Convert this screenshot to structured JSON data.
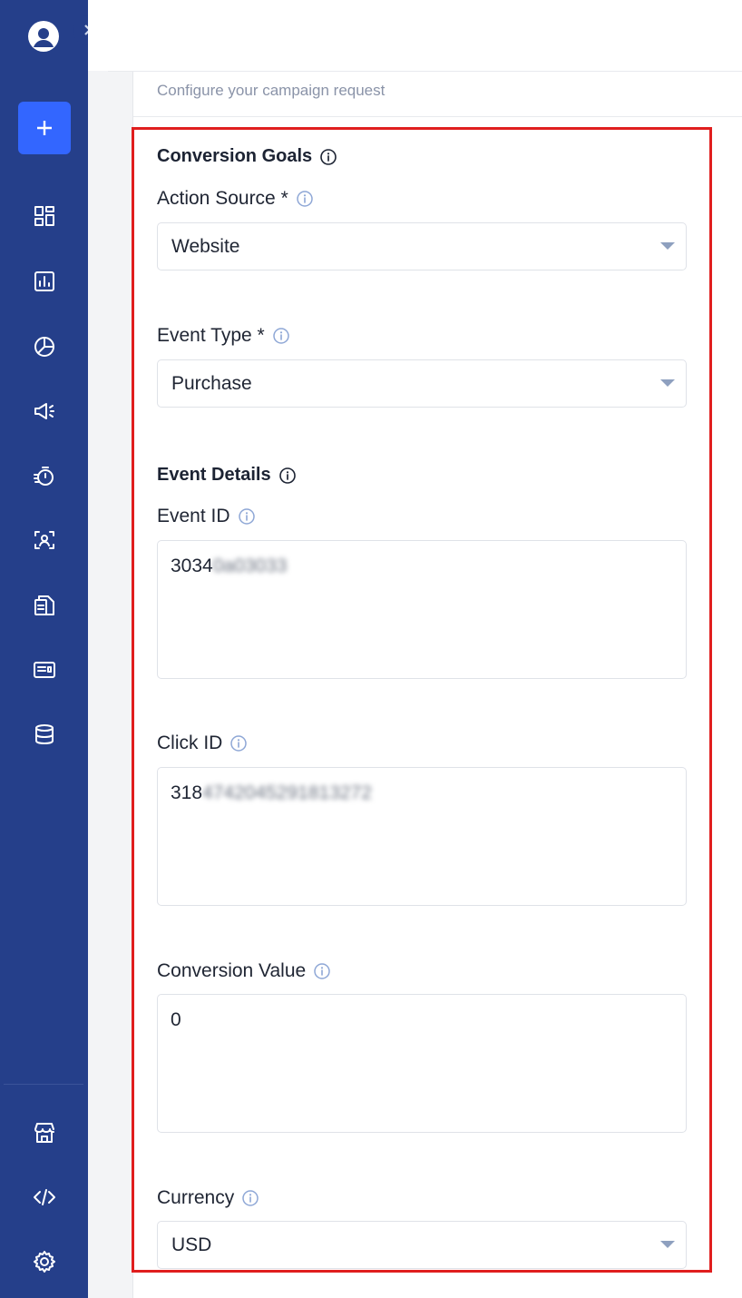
{
  "panel": {
    "subtitle": "Configure your campaign request"
  },
  "conversion_goals": {
    "title": "Conversion Goals",
    "action_source": {
      "label": "Action Source *",
      "value": "Website"
    },
    "event_type": {
      "label": "Event Type *",
      "value": "Purchase"
    }
  },
  "event_details": {
    "title": "Event Details",
    "event_id": {
      "label": "Event ID",
      "value_visible": "3034",
      "value_blurred": "0a03033"
    },
    "click_id": {
      "label": "Click ID",
      "value_visible": "318",
      "value_blurred": "4742045291813272"
    },
    "conversion_value": {
      "label": "Conversion Value",
      "value": "0"
    },
    "currency": {
      "label": "Currency",
      "value": "USD"
    }
  },
  "sidebar": {
    "icons": [
      "avatar-icon",
      "expand-chevron-icon",
      "plus-icon",
      "dashboard-icon",
      "report-chart-icon",
      "pie-chart-icon",
      "megaphone-icon",
      "timer-icon",
      "contact-card-icon",
      "documents-icon",
      "news-card-icon",
      "database-icon",
      "store-icon",
      "code-icon",
      "gear-icon"
    ]
  },
  "colors": {
    "sidebar": "#253f8a",
    "accent": "#3366ff",
    "highlight_border": "#e01e1e"
  }
}
